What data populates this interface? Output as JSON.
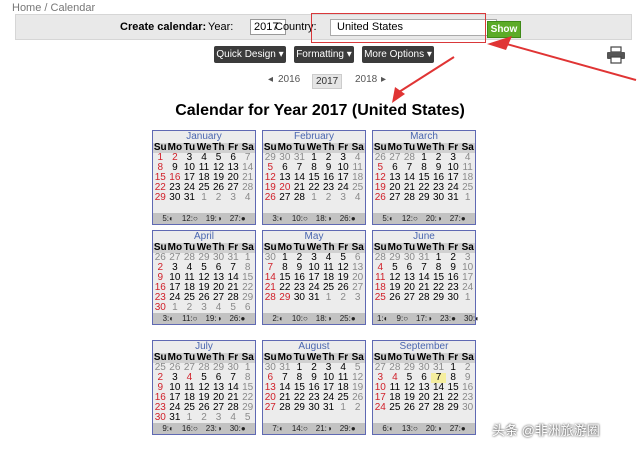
{
  "breadcrumb": {
    "home": "Home",
    "separator": "/",
    "current": "Calendar"
  },
  "form": {
    "create_label": "Create calendar:",
    "year_label": "Year:",
    "year_value": "2017",
    "country_label": "Country:",
    "country_value": "United States",
    "show_label": "Show"
  },
  "design": {
    "quick_design": "Quick Design",
    "formatting": "Formatting",
    "more_options": "More Options"
  },
  "year_nav": {
    "prev": "2016",
    "current": "2017",
    "next": "2018"
  },
  "title": "Calendar for Year 2017 (United States)",
  "weekday_headers": [
    "Su",
    "Mo",
    "Tu",
    "We",
    "Th",
    "Fr",
    "Sa"
  ],
  "months": [
    {
      "name": "January",
      "first_weekday": 0,
      "days": 31,
      "prev_days": [],
      "next_days": [
        "1",
        "2",
        "3",
        "4"
      ],
      "red_days": [
        1,
        2,
        16
      ],
      "moons": [
        "5",
        "12",
        "19",
        "27"
      ]
    },
    {
      "name": "February",
      "first_weekday": 3,
      "days": 28,
      "prev_days": [
        "29",
        "30",
        "31"
      ],
      "next_days": [
        "1",
        "2",
        "3",
        "4"
      ],
      "red_days": [
        20
      ],
      "moons": [
        "3",
        "10",
        "18",
        "26"
      ]
    },
    {
      "name": "March",
      "first_weekday": 3,
      "days": 31,
      "prev_days": [
        "26",
        "27",
        "28"
      ],
      "next_days": [
        "1"
      ],
      "red_days": [],
      "moons": [
        "5",
        "12",
        "20",
        "27"
      ]
    },
    {
      "name": "April",
      "first_weekday": 6,
      "days": 30,
      "prev_days": [
        "26",
        "27",
        "28",
        "29",
        "30",
        "31"
      ],
      "next_days": [
        "1",
        "2",
        "3",
        "4",
        "5",
        "6"
      ],
      "red_days": [],
      "moons": [
        "3",
        "11",
        "19",
        "26"
      ]
    },
    {
      "name": "May",
      "first_weekday": 1,
      "days": 31,
      "prev_days": [
        "30"
      ],
      "next_days": [
        "1",
        "2",
        "3"
      ],
      "red_days": [
        14,
        29
      ],
      "moons": [
        "2",
        "10",
        "18",
        "25"
      ]
    },
    {
      "name": "June",
      "first_weekday": 4,
      "days": 30,
      "prev_days": [
        "28",
        "29",
        "30",
        "31"
      ],
      "next_days": [
        "1"
      ],
      "red_days": [
        18
      ],
      "moons": [
        "1",
        "9",
        "17",
        "23",
        "30"
      ]
    },
    {
      "name": "July",
      "first_weekday": 6,
      "days": 31,
      "prev_days": [
        "25",
        "26",
        "27",
        "28",
        "29",
        "30"
      ],
      "next_days": [
        "1",
        "2",
        "3",
        "4",
        "5"
      ],
      "red_days": [
        4
      ],
      "moons": [
        "9",
        "16",
        "23",
        "30"
      ]
    },
    {
      "name": "August",
      "first_weekday": 2,
      "days": 31,
      "prev_days": [
        "30",
        "31"
      ],
      "next_days": [
        "1",
        "2"
      ],
      "red_days": [],
      "moons": [
        "7",
        "14",
        "21",
        "29"
      ]
    },
    {
      "name": "September",
      "first_weekday": 5,
      "days": 30,
      "prev_days": [
        "27",
        "28",
        "29",
        "30",
        "31"
      ],
      "next_days": [],
      "red_days": [
        4
      ],
      "highlight_days": [
        7
      ],
      "moons": [
        "6",
        "13",
        "20",
        "27"
      ]
    }
  ],
  "watermark": "头条 @非洲旅游圈"
}
